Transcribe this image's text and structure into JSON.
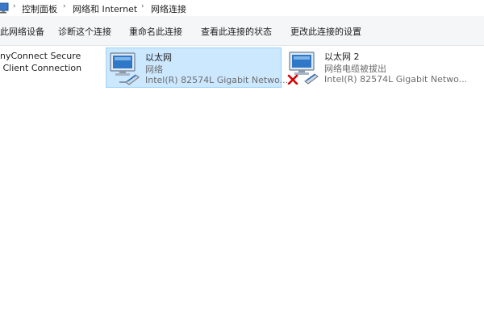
{
  "breadcrumb": {
    "items": [
      "控制面板",
      "网络和 Internet",
      "网络连接"
    ],
    "separator": "›"
  },
  "toolbar": {
    "disable_device": "禁用此网络设备",
    "diagnose": "诊断这个连接",
    "rename": "重命名此连接",
    "view_status": "查看此连接的状态",
    "change_settings": "更改此连接的设置"
  },
  "connections": [
    {
      "name": "Cisco AnyConnect Secure Mobility Client Connection",
      "visible_text": "nyConnect Secure\n Client Connection"
    },
    {
      "name": "以太网",
      "status": "网络",
      "device": "Intel(R) 82574L Gigabit Netwo...",
      "selected": true,
      "icon": "network-adapter-icon"
    },
    {
      "name": "以太网 2",
      "status": "网络电缆被拔出",
      "device": "Intel(R) 82574L Gigabit Netwo...",
      "selected": false,
      "icon": "network-adapter-unplugged-icon"
    }
  ],
  "colors": {
    "selection_bg": "#cce8ff",
    "selection_border": "#99d1ff",
    "toolbar_bg": "#f5f6f7",
    "error_red": "#d90000"
  }
}
